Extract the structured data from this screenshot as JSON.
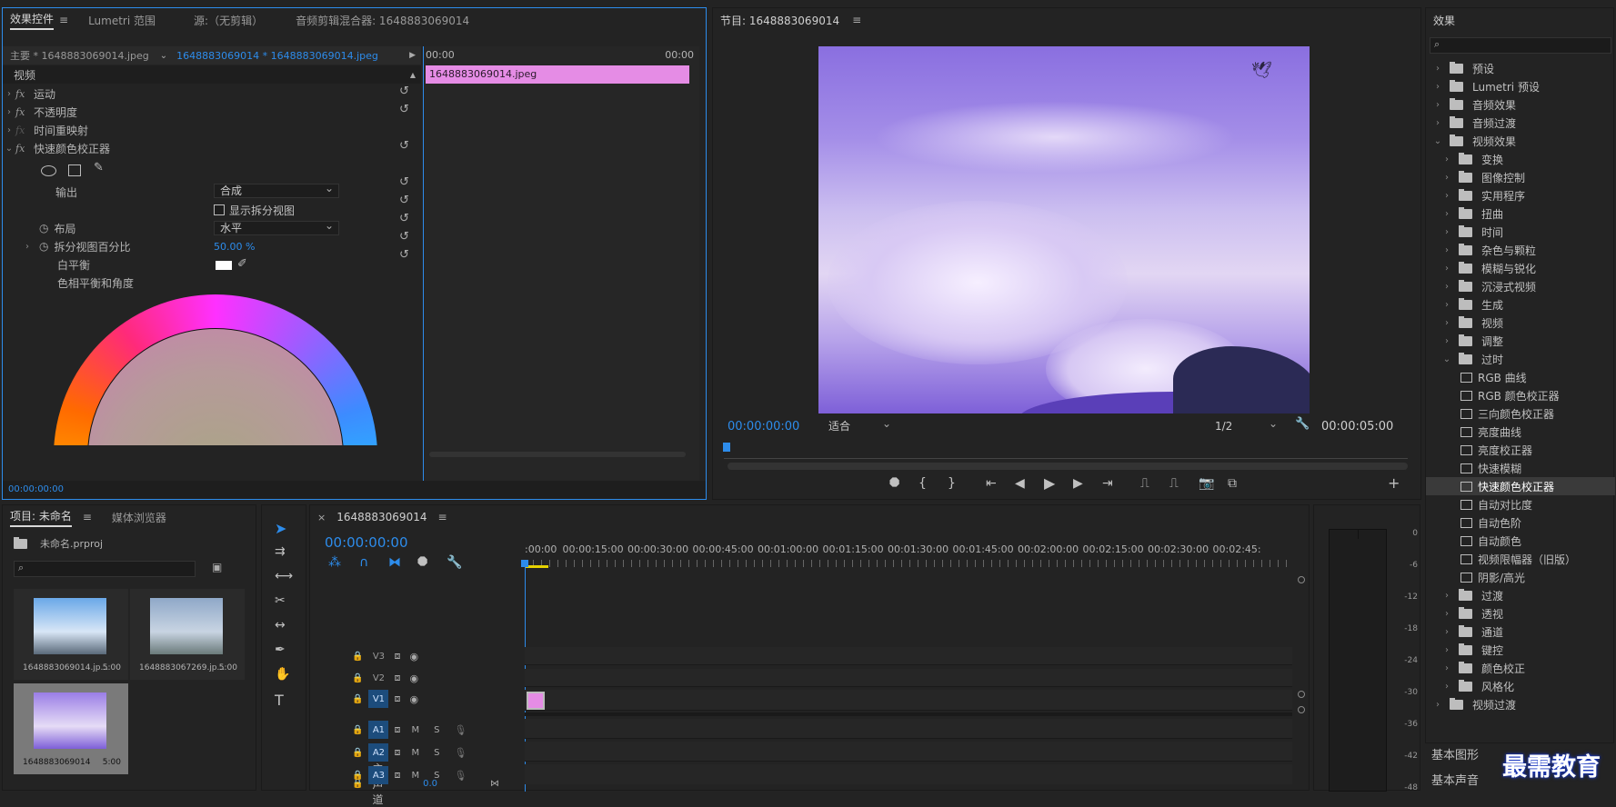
{
  "effect_controls": {
    "tabs": [
      "效果控件",
      "Lumetri 范围",
      "源:（无剪辑）",
      "音频剪辑混合器: 1648883069014"
    ],
    "master_label": "主要 * 1648883069014.jpeg",
    "sequence_label": "1648883069014 * 1648883069014.jpeg",
    "section_video": "视频",
    "effects": [
      "运动",
      "不透明度",
      "时间重映射",
      "快速颜色校正器"
    ],
    "output_label": "输出",
    "output_value": "合成",
    "split_view_label": "显示拆分视图",
    "layout_label": "布局",
    "layout_value": "水平",
    "split_percent_label": "拆分视图百分比",
    "split_percent_value": "50.00 %",
    "white_balance_label": "白平衡",
    "hue_balance_label": "色相平衡和角度",
    "timeline_start": "00:00",
    "timeline_end": "00:00",
    "clip_name": "1648883069014.jpeg",
    "current_time": "00:00:00:00"
  },
  "program": {
    "title": "节目: 1648883069014",
    "timecode_left": "00:00:00:00",
    "fit_value": "适合",
    "resolution_value": "1/2",
    "timecode_right": "00:00:05:00"
  },
  "effects_panel": {
    "title": "效果",
    "items": [
      {
        "label": "预设",
        "level": 0,
        "open": false
      },
      {
        "label": "Lumetri 预设",
        "level": 0,
        "open": false
      },
      {
        "label": "音频效果",
        "level": 0,
        "open": false
      },
      {
        "label": "音频过渡",
        "level": 0,
        "open": false
      },
      {
        "label": "视频效果",
        "level": 0,
        "open": true
      },
      {
        "label": "变换",
        "level": 1,
        "open": false
      },
      {
        "label": "图像控制",
        "level": 1,
        "open": false
      },
      {
        "label": "实用程序",
        "level": 1,
        "open": false
      },
      {
        "label": "扭曲",
        "level": 1,
        "open": false
      },
      {
        "label": "时间",
        "level": 1,
        "open": false
      },
      {
        "label": "杂色与颗粒",
        "level": 1,
        "open": false
      },
      {
        "label": "模糊与锐化",
        "level": 1,
        "open": false
      },
      {
        "label": "沉浸式视频",
        "level": 1,
        "open": false
      },
      {
        "label": "生成",
        "level": 1,
        "open": false
      },
      {
        "label": "视频",
        "level": 1,
        "open": false
      },
      {
        "label": "调整",
        "level": 1,
        "open": false
      },
      {
        "label": "过时",
        "level": 1,
        "open": true
      },
      {
        "label": "RGB 曲线",
        "level": 2
      },
      {
        "label": "RGB 颜色校正器",
        "level": 2
      },
      {
        "label": "三向颜色校正器",
        "level": 2
      },
      {
        "label": "亮度曲线",
        "level": 2
      },
      {
        "label": "亮度校正器",
        "level": 2
      },
      {
        "label": "快速模糊",
        "level": 2
      },
      {
        "label": "快速颜色校正器",
        "level": 2,
        "selected": true
      },
      {
        "label": "自动对比度",
        "level": 2
      },
      {
        "label": "自动色阶",
        "level": 2
      },
      {
        "label": "自动颜色",
        "level": 2
      },
      {
        "label": "视频限幅器（旧版）",
        "level": 2
      },
      {
        "label": "阴影/高光",
        "level": 2
      },
      {
        "label": "过渡",
        "level": 1,
        "open": false
      },
      {
        "label": "透视",
        "level": 1,
        "open": false
      },
      {
        "label": "通道",
        "level": 1,
        "open": false
      },
      {
        "label": "键控",
        "level": 1,
        "open": false
      },
      {
        "label": "颜色校正",
        "level": 1,
        "open": false
      },
      {
        "label": "风格化",
        "level": 1,
        "open": false
      },
      {
        "label": "视频过渡",
        "level": 0,
        "open": false
      }
    ],
    "basic_graphics": "基本图形",
    "basic_sound": "基本声音"
  },
  "project": {
    "tabs": [
      "项目: 未命名",
      "媒体浏览器"
    ],
    "file_name": "未命名.prproj",
    "items": [
      {
        "name": "1648883069014.jp...",
        "duration": "5:00"
      },
      {
        "name": "1648883067269.jp...",
        "duration": "5:00"
      },
      {
        "name": "1648883069014",
        "duration": "5:00"
      }
    ]
  },
  "timeline": {
    "tab": "1648883069014",
    "timecode": "00:00:00:00",
    "ruler": [
      ":00:00",
      "00:00:15:00",
      "00:00:30:00",
      "00:00:45:00",
      "00:01:00:00",
      "00:01:15:00",
      "00:01:30:00",
      "00:01:45:00",
      "00:02:00:00",
      "00:02:15:00",
      "00:02:30:00",
      "00:02:45:"
    ],
    "video_tracks": [
      "V3",
      "V2",
      "V1"
    ],
    "audio_tracks": [
      "A1",
      "A2",
      "A3"
    ],
    "master_label": "主声道",
    "master_value": "0.0",
    "mute": "M",
    "solo": "S"
  },
  "meter": {
    "labels": [
      "0",
      "-6",
      "-12",
      "-18",
      "-24",
      "-30",
      "-36",
      "-42",
      "-48"
    ]
  },
  "watermark": "最需教育",
  "colors": {
    "accent": "#2d8ceb",
    "clip": "#e58ce5",
    "sky": "#9a7ee6"
  }
}
